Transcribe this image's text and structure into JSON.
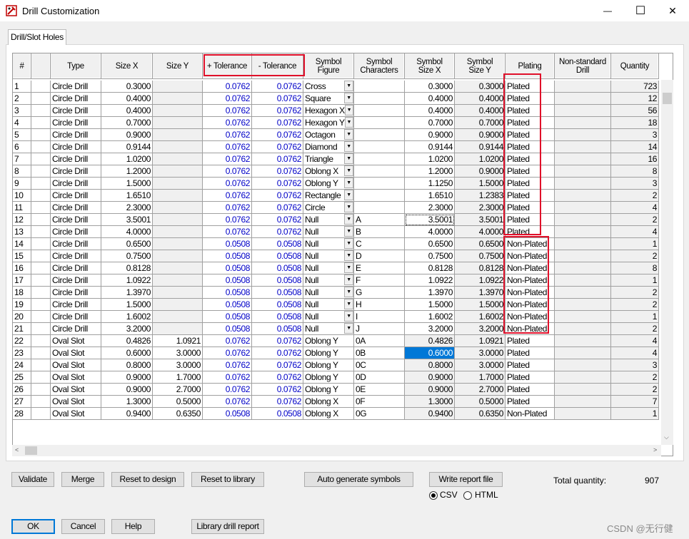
{
  "window": {
    "title": "Drill Customization",
    "minimize_glyph": "—",
    "maximize_glyph": "☐",
    "close_glyph": "✕"
  },
  "tab": {
    "label": "Drill/Slot Holes"
  },
  "grid": {
    "columns": [
      {
        "key": "num",
        "label": "#",
        "w": 26
      },
      {
        "key": "blank",
        "label": "",
        "w": 27
      },
      {
        "key": "type",
        "label": "Type",
        "w": 71
      },
      {
        "key": "sx",
        "label": "Size X",
        "w": 72
      },
      {
        "key": "sy",
        "label": "Size Y",
        "w": 70
      },
      {
        "key": "ptol",
        "label": "+ Tolerance",
        "w": 69
      },
      {
        "key": "mtol",
        "label": "- Tolerance",
        "w": 72
      },
      {
        "key": "fig",
        "label": "Symbol\nFigure",
        "w": 71
      },
      {
        "key": "chars",
        "label": "Symbol\nCharacters",
        "w": 71
      },
      {
        "key": "ssx",
        "label": "Symbol\nSize X",
        "w": 70
      },
      {
        "key": "ssy",
        "label": "Symbol\nSize Y",
        "w": 71
      },
      {
        "key": "plating",
        "label": "Plating",
        "w": 69
      },
      {
        "key": "nonstd",
        "label": "Non-standard\nDrill",
        "w": 79
      },
      {
        "key": "qty",
        "label": "Quantity",
        "w": 67
      }
    ],
    "rows": [
      [
        "1",
        "",
        "Circle Drill",
        "0.3000",
        "",
        "0.0762",
        "0.0762",
        "Cross",
        "",
        "0.3000",
        "0.3000",
        "Plated",
        "",
        "723"
      ],
      [
        "2",
        "",
        "Circle Drill",
        "0.4000",
        "",
        "0.0762",
        "0.0762",
        "Square",
        "",
        "0.4000",
        "0.4000",
        "Plated",
        "",
        "12"
      ],
      [
        "3",
        "",
        "Circle Drill",
        "0.4000",
        "",
        "0.0762",
        "0.0762",
        "Hexagon X",
        "",
        "0.4000",
        "0.4000",
        "Plated",
        "",
        "56"
      ],
      [
        "4",
        "",
        "Circle Drill",
        "0.7000",
        "",
        "0.0762",
        "0.0762",
        "Hexagon Y",
        "",
        "0.7000",
        "0.7000",
        "Plated",
        "",
        "18"
      ],
      [
        "5",
        "",
        "Circle Drill",
        "0.9000",
        "",
        "0.0762",
        "0.0762",
        "Octagon",
        "",
        "0.9000",
        "0.9000",
        "Plated",
        "",
        "3"
      ],
      [
        "6",
        "",
        "Circle Drill",
        "0.9144",
        "",
        "0.0762",
        "0.0762",
        "Diamond",
        "",
        "0.9144",
        "0.9144",
        "Plated",
        "",
        "14"
      ],
      [
        "7",
        "",
        "Circle Drill",
        "1.0200",
        "",
        "0.0762",
        "0.0762",
        "Triangle",
        "",
        "1.0200",
        "1.0200",
        "Plated",
        "",
        "16"
      ],
      [
        "8",
        "",
        "Circle Drill",
        "1.2000",
        "",
        "0.0762",
        "0.0762",
        "Oblong X",
        "",
        "1.2000",
        "0.9000",
        "Plated",
        "",
        "8"
      ],
      [
        "9",
        "",
        "Circle Drill",
        "1.5000",
        "",
        "0.0762",
        "0.0762",
        "Oblong Y",
        "",
        "1.1250",
        "1.5000",
        "Plated",
        "",
        "3"
      ],
      [
        "10",
        "",
        "Circle Drill",
        "1.6510",
        "",
        "0.0762",
        "0.0762",
        "Rectangle",
        "",
        "1.6510",
        "1.2383",
        "Plated",
        "",
        "2"
      ],
      [
        "11",
        "",
        "Circle Drill",
        "2.3000",
        "",
        "0.0762",
        "0.0762",
        "Circle",
        "",
        "2.3000",
        "2.3000",
        "Plated",
        "",
        "4"
      ],
      [
        "12",
        "",
        "Circle Drill",
        "3.5001",
        "",
        "0.0762",
        "0.0762",
        "Null",
        "A",
        "3.5001",
        "3.5001",
        "Plated",
        "",
        "2"
      ],
      [
        "13",
        "",
        "Circle Drill",
        "4.0000",
        "",
        "0.0762",
        "0.0762",
        "Null",
        "B",
        "4.0000",
        "4.0000",
        "Plated",
        "",
        "4"
      ],
      [
        "14",
        "",
        "Circle Drill",
        "0.6500",
        "",
        "0.0508",
        "0.0508",
        "Null",
        "C",
        "0.6500",
        "0.6500",
        "Non-Plated",
        "",
        "1"
      ],
      [
        "15",
        "",
        "Circle Drill",
        "0.7500",
        "",
        "0.0508",
        "0.0508",
        "Null",
        "D",
        "0.7500",
        "0.7500",
        "Non-Plated",
        "",
        "2"
      ],
      [
        "16",
        "",
        "Circle Drill",
        "0.8128",
        "",
        "0.0508",
        "0.0508",
        "Null",
        "E",
        "0.8128",
        "0.8128",
        "Non-Plated",
        "",
        "8"
      ],
      [
        "17",
        "",
        "Circle Drill",
        "1.0922",
        "",
        "0.0508",
        "0.0508",
        "Null",
        "F",
        "1.0922",
        "1.0922",
        "Non-Plated",
        "",
        "1"
      ],
      [
        "18",
        "",
        "Circle Drill",
        "1.3970",
        "",
        "0.0508",
        "0.0508",
        "Null",
        "G",
        "1.3970",
        "1.3970",
        "Non-Plated",
        "",
        "2"
      ],
      [
        "19",
        "",
        "Circle Drill",
        "1.5000",
        "",
        "0.0508",
        "0.0508",
        "Null",
        "H",
        "1.5000",
        "1.5000",
        "Non-Plated",
        "",
        "2"
      ],
      [
        "20",
        "",
        "Circle Drill",
        "1.6002",
        "",
        "0.0508",
        "0.0508",
        "Null",
        "I",
        "1.6002",
        "1.6002",
        "Non-Plated",
        "",
        "1"
      ],
      [
        "21",
        "",
        "Circle Drill",
        "3.2000",
        "",
        "0.0508",
        "0.0508",
        "Null",
        "J",
        "3.2000",
        "3.2000",
        "Non-Plated",
        "",
        "2"
      ],
      [
        "22",
        "",
        "Oval Slot",
        "0.4826",
        "1.0921",
        "0.0762",
        "0.0762",
        "Oblong Y",
        "0A",
        "0.4826",
        "1.0921",
        "Plated",
        "",
        "4"
      ],
      [
        "23",
        "",
        "Oval Slot",
        "0.6000",
        "3.0000",
        "0.0762",
        "0.0762",
        "Oblong Y",
        "0B",
        "0.6000",
        "3.0000",
        "Plated",
        "",
        "4"
      ],
      [
        "24",
        "",
        "Oval Slot",
        "0.8000",
        "3.0000",
        "0.0762",
        "0.0762",
        "Oblong Y",
        "0C",
        "0.8000",
        "3.0000",
        "Plated",
        "",
        "3"
      ],
      [
        "25",
        "",
        "Oval Slot",
        "0.9000",
        "1.7000",
        "0.0762",
        "0.0762",
        "Oblong Y",
        "0D",
        "0.9000",
        "1.7000",
        "Plated",
        "",
        "2"
      ],
      [
        "26",
        "",
        "Oval Slot",
        "0.9000",
        "2.7000",
        "0.0762",
        "0.0762",
        "Oblong Y",
        "0E",
        "0.9000",
        "2.7000",
        "Plated",
        "",
        "2"
      ],
      [
        "27",
        "",
        "Oval Slot",
        "1.3000",
        "0.5000",
        "0.0762",
        "0.0762",
        "Oblong X",
        "0F",
        "1.3000",
        "0.5000",
        "Plated",
        "",
        "7"
      ],
      [
        "28",
        "",
        "Oval Slot",
        "0.9400",
        "0.6350",
        "0.0508",
        "0.0508",
        "Oblong X",
        "0G",
        "0.9400",
        "0.6350",
        "Non-Plated",
        "",
        "1"
      ]
    ],
    "selected_cell": {
      "row": 23,
      "col": "ssx"
    },
    "focused_cell": {
      "row": 12,
      "col": "ssx"
    },
    "tolerance_color": "#0000c8",
    "selection_color": "#0078d7",
    "highlight_color": "#e0102a"
  },
  "buttons": {
    "validate": "Validate",
    "merge": "Merge",
    "reset_design": "Reset to design",
    "reset_library": "Reset to library",
    "auto_generate": "Auto generate symbols",
    "write_report": "Write report file",
    "ok": "OK",
    "cancel": "Cancel",
    "help": "Help",
    "library_report": "Library drill report"
  },
  "report_format": {
    "options": [
      "CSV",
      "HTML"
    ],
    "selected": "CSV"
  },
  "total": {
    "label": "Total quantity:",
    "value": "907"
  },
  "watermark": "CSDN @无行健"
}
